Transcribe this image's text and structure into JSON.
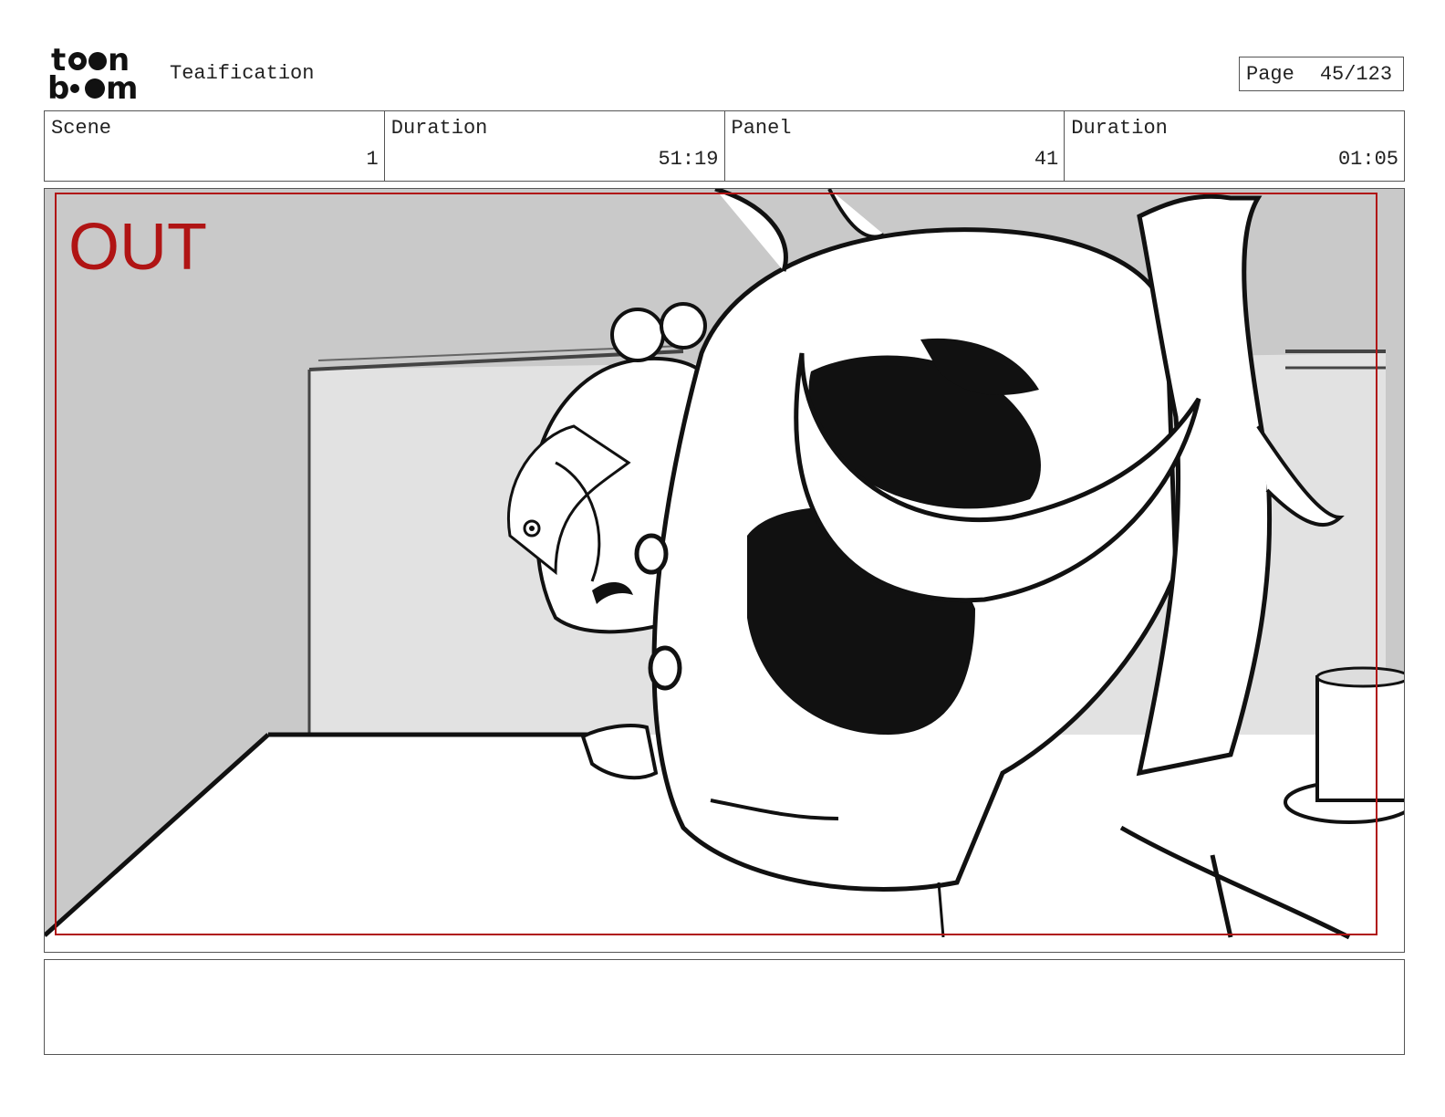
{
  "header": {
    "logo_text": "toon boom",
    "project_title": "Teaification",
    "page_label": "Page",
    "page_number": "45/123"
  },
  "info": {
    "scene_label": "Scene",
    "scene_value": "1",
    "scene_duration_label": "Duration",
    "scene_duration_value": "51:19",
    "panel_label": "Panel",
    "panel_value": "41",
    "panel_duration_label": "Duration",
    "panel_duration_value": "01:05"
  },
  "panel": {
    "transition_label": "OUT",
    "safe_frame_color": "#b01414"
  },
  "notes": {
    "text": ""
  }
}
